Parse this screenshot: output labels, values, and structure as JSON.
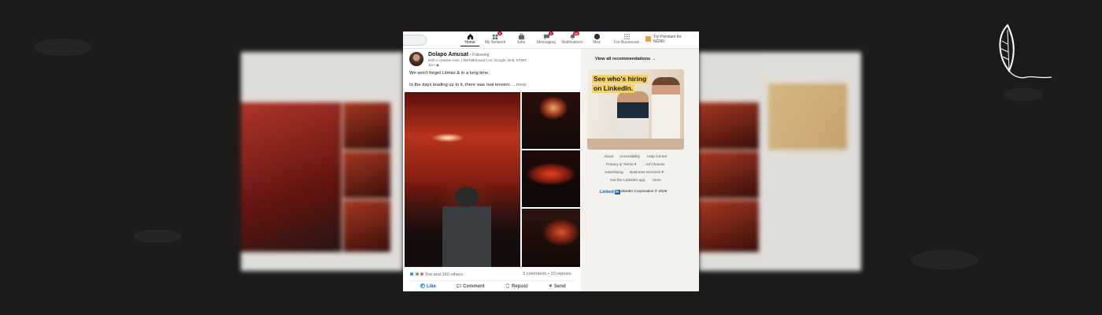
{
  "nav": {
    "items": [
      {
        "label": "Home",
        "badge": ""
      },
      {
        "label": "My Network",
        "badge": "6"
      },
      {
        "label": "Jobs",
        "badge": ""
      },
      {
        "label": "Messaging",
        "badge": "1"
      },
      {
        "label": "Notifications",
        "badge": "18"
      },
      {
        "label": "Me",
        "badge": ""
      },
      {
        "label": "For Business",
        "badge": ""
      }
    ],
    "premium": {
      "line1": "Try Premium for",
      "line2": "NGN0"
    }
  },
  "post": {
    "author": "Dolapo Amusat",
    "follow": "• Following",
    "headline": "tech x creative exec | WeTalkSound | ex: Google, Bolt, KPMG",
    "time": "1w •",
    "text_line1": "We won't forget Litmas & in a long time.",
    "text_line2": "In the days leading up to it, there was real tension.",
    "more": "...more",
    "reactions": "You and 160 others",
    "counts": "3 comments • 10 reposts",
    "actions": {
      "like": "Like",
      "comment": "Comment",
      "repost": "Repost",
      "send": "Send"
    }
  },
  "sidebar": {
    "recommendations": "View all recommendations →",
    "ad": {
      "line1": "See who's hiring",
      "line2": "on LinkedIn."
    },
    "footer": {
      "about": "About",
      "accessibility": "Accessibility",
      "help": "Help Center",
      "privacy": "Privacy & Terms ▾",
      "adchoices": "Ad Choices",
      "advertising": "Advertising",
      "business": "Business Services ▾",
      "app": "Get the LinkedIn app",
      "more": "More",
      "brand": "Linked",
      "brand_in": "in",
      "copyright": "LinkedIn Corporation © 2026"
    }
  },
  "colors": {
    "accent": "#0a66c2",
    "badge": "#cb112d",
    "highlight": "#f4d55a"
  }
}
